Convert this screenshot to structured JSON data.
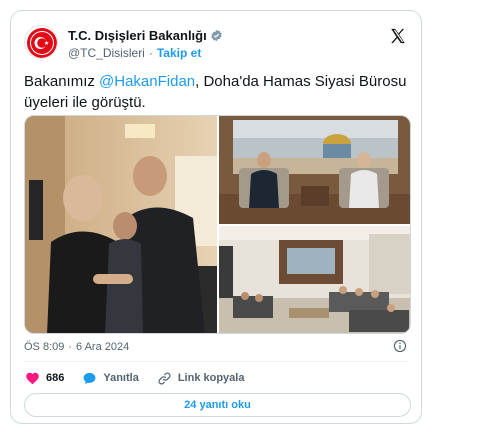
{
  "account": {
    "name": "T.C. Dışişleri Bakanlığı",
    "handle": "@TC_Disisleri",
    "separator": "·",
    "follow_label": "Takip et",
    "brand_color": "#1d9bf0",
    "flag_color": "#e30a17"
  },
  "tweet": {
    "text_before": "Bakanımız ",
    "mention": "@HakanFidan",
    "text_after": ", Doha'da Hamas Siyasi Bürosu üyeleri ile görüştü."
  },
  "meta": {
    "time": "ÖS 8:09",
    "separator": "·",
    "date": "6 Ara 2024"
  },
  "actions": {
    "like_count": "686",
    "reply_label": "Yanıtla",
    "copy_link_label": "Link kopyala",
    "like_color": "#f91880"
  },
  "replies_button": {
    "label": "24 yanıtı oku"
  },
  "icons": [
    "verified-badge-icon",
    "x-logo-icon",
    "info-icon",
    "heart-icon",
    "reply-bubble-icon",
    "link-icon"
  ]
}
